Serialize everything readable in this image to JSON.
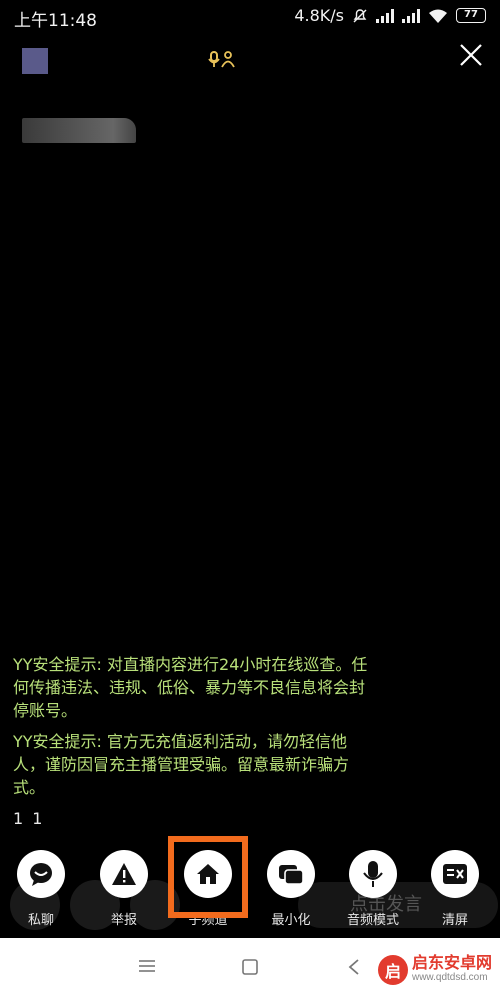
{
  "status_bar": {
    "time": "上午11:48",
    "net_speed": "4.8K/s",
    "battery": "77"
  },
  "overlay": {
    "audience_icon": "mic-people-icon",
    "close_icon": "close-icon"
  },
  "chat": {
    "messages": [
      "YY安全提示: 对直播内容进行24小时在线巡查。任何传播违法、违规、低俗、暴力等不良信息将会封停账号。",
      "YY安全提示: 官方无充值返利活动，请勿轻信他人，谨防因冒充主播管理受骗。留意最新诈骗方式。"
    ],
    "plain": "1 1"
  },
  "background": {
    "input_placeholder": "点击发言"
  },
  "actions": [
    {
      "label": "私聊",
      "icon": "chat-bubble-icon"
    },
    {
      "label": "举报",
      "icon": "warning-icon"
    },
    {
      "label": "子频道",
      "icon": "home-icon"
    },
    {
      "label": "最小化",
      "icon": "minimize-window-icon"
    },
    {
      "label": "音频模式",
      "icon": "microphone-icon"
    },
    {
      "label": "清屏",
      "icon": "clear-screen-icon"
    }
  ],
  "colors": {
    "accent_highlight": "#f26b1d",
    "chat_text": "#b8e07a"
  },
  "watermark": {
    "title": "启东安卓网",
    "url": "www.qdtdsd.com"
  }
}
